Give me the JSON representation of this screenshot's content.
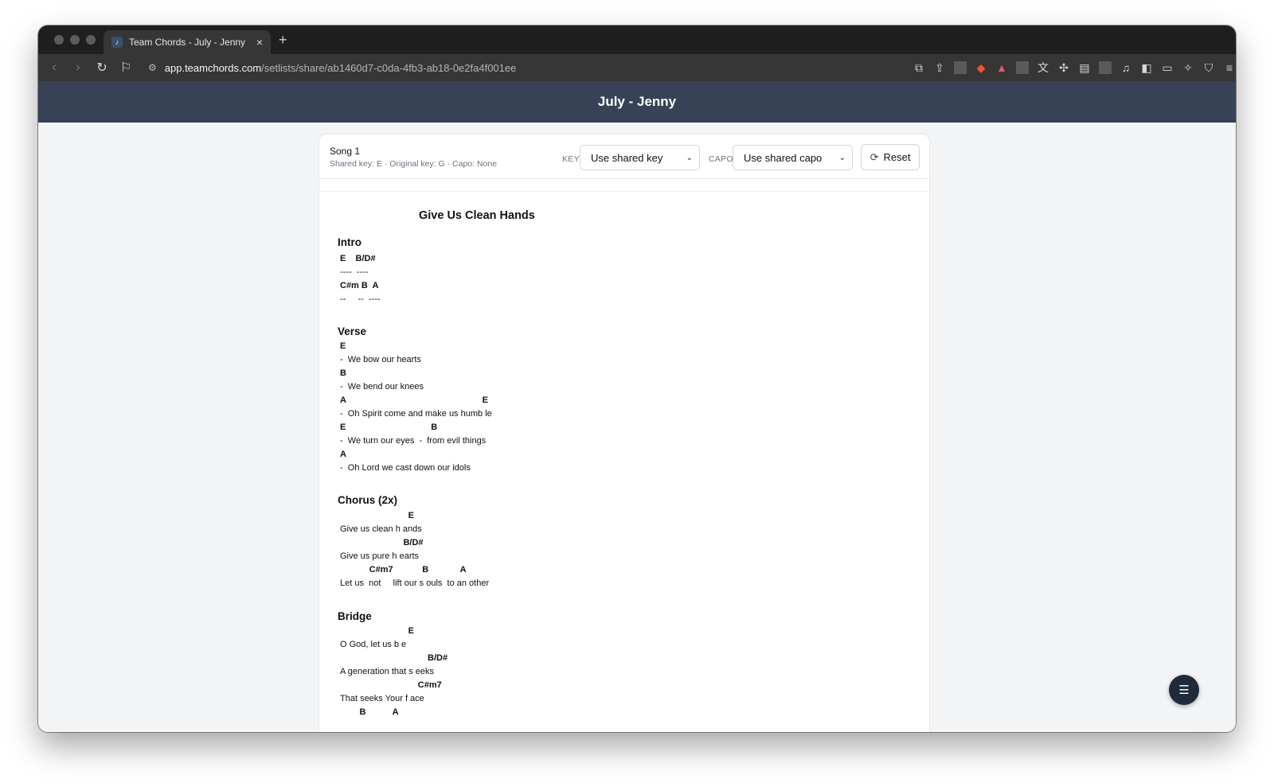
{
  "browser": {
    "tab_title": "Team Chords - July - Jenny",
    "tab_close": "×",
    "new_tab": "+",
    "url_host": "app.teamchords.com",
    "url_path": "/setlists/share/ab1460d7-c0da-4fb3-ab18-0e2fa4f001ee"
  },
  "app": {
    "header_title": "July - Jenny"
  },
  "song_bar": {
    "song_label": "Song 1",
    "meta": "Shared key: E · Original key: G · Capo: None",
    "key_label": "KEY",
    "key_value": "Use shared key",
    "capo_label": "CAPO",
    "capo_value": "Use shared capo",
    "reset_label": "Reset"
  },
  "sheet": {
    "title": "Give Us Clean Hands",
    "sections": [
      {
        "name": "Intro",
        "lines": [
          {
            "type": "chord",
            "text": "E    B/D#"
          },
          {
            "type": "lyric",
            "text": "----  ----"
          },
          {
            "type": "chord",
            "text": "C#m B  A"
          },
          {
            "type": "lyric",
            "text": "--     --  ----"
          }
        ]
      },
      {
        "name": "Verse",
        "lines": [
          {
            "type": "chord",
            "text": "E"
          },
          {
            "type": "lyric",
            "text": "-  We bow our hearts"
          },
          {
            "type": "chord",
            "text": "B"
          },
          {
            "type": "lyric",
            "text": "-  We bend our knees"
          },
          {
            "type": "chord",
            "text": "A                                                        E"
          },
          {
            "type": "lyric",
            "text": "-  Oh Spirit come and make us humb le"
          },
          {
            "type": "chord",
            "text": "E                                   B"
          },
          {
            "type": "lyric",
            "text": "-  We turn our eyes  -  from evil things"
          },
          {
            "type": "chord",
            "text": "A"
          },
          {
            "type": "lyric",
            "text": "-  Oh Lord we cast down our idols"
          }
        ]
      },
      {
        "name": "Chorus (2x)",
        "lines": [
          {
            "type": "chord",
            "text": "                            E"
          },
          {
            "type": "lyric",
            "text": "Give us clean h ands"
          },
          {
            "type": "chord",
            "text": "                          B/D#"
          },
          {
            "type": "lyric",
            "text": "Give us pure h earts"
          },
          {
            "type": "chord",
            "text": "            C#m7            B             A"
          },
          {
            "type": "lyric",
            "text": "Let us  not     lift our s ouls  to an other"
          }
        ]
      },
      {
        "name": "Bridge",
        "lines": [
          {
            "type": "chord",
            "text": "                            E"
          },
          {
            "type": "lyric",
            "text": "O God, let us b e"
          },
          {
            "type": "chord",
            "text": "                                    B/D#"
          },
          {
            "type": "lyric",
            "text": "A generation that s eeks"
          },
          {
            "type": "chord",
            "text": "                                C#m7"
          },
          {
            "type": "lyric",
            "text": "That seeks Your f ace"
          },
          {
            "type": "chord",
            "text": "        B           A"
          }
        ]
      }
    ]
  }
}
